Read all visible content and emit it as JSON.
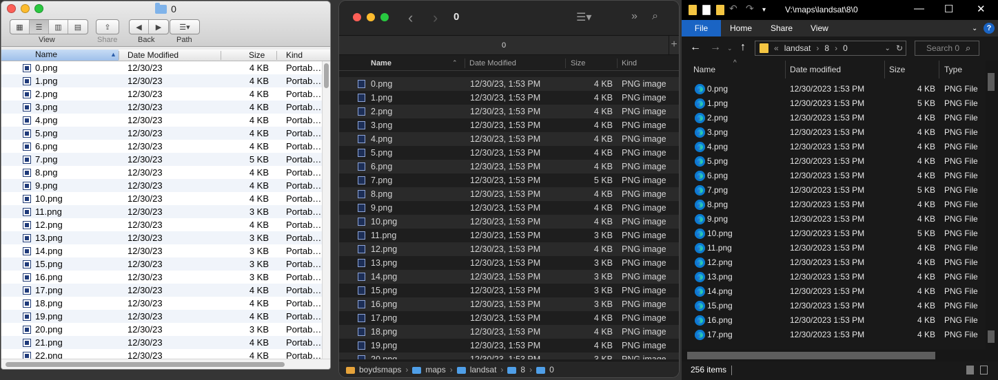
{
  "finder_old": {
    "title": "0",
    "toolbar": {
      "view": "View",
      "share": "Share",
      "back": "Back",
      "path": "Path"
    },
    "columns": {
      "name": "Name",
      "date": "Date Modified",
      "size": "Size",
      "kind": "Kind"
    },
    "rows": [
      {
        "name": "0.png",
        "date": "12/30/23",
        "size": "4 KB",
        "kind": "Portab…"
      },
      {
        "name": "1.png",
        "date": "12/30/23",
        "size": "4 KB",
        "kind": "Portab…"
      },
      {
        "name": "2.png",
        "date": "12/30/23",
        "size": "4 KB",
        "kind": "Portab…"
      },
      {
        "name": "3.png",
        "date": "12/30/23",
        "size": "4 KB",
        "kind": "Portab…"
      },
      {
        "name": "4.png",
        "date": "12/30/23",
        "size": "4 KB",
        "kind": "Portab…"
      },
      {
        "name": "5.png",
        "date": "12/30/23",
        "size": "4 KB",
        "kind": "Portab…"
      },
      {
        "name": "6.png",
        "date": "12/30/23",
        "size": "4 KB",
        "kind": "Portab…"
      },
      {
        "name": "7.png",
        "date": "12/30/23",
        "size": "5 KB",
        "kind": "Portab…"
      },
      {
        "name": "8.png",
        "date": "12/30/23",
        "size": "4 KB",
        "kind": "Portab…"
      },
      {
        "name": "9.png",
        "date": "12/30/23",
        "size": "4 KB",
        "kind": "Portab…"
      },
      {
        "name": "10.png",
        "date": "12/30/23",
        "size": "4 KB",
        "kind": "Portab…"
      },
      {
        "name": "11.png",
        "date": "12/30/23",
        "size": "3 KB",
        "kind": "Portab…"
      },
      {
        "name": "12.png",
        "date": "12/30/23",
        "size": "4 KB",
        "kind": "Portab…"
      },
      {
        "name": "13.png",
        "date": "12/30/23",
        "size": "3 KB",
        "kind": "Portab…"
      },
      {
        "name": "14.png",
        "date": "12/30/23",
        "size": "3 KB",
        "kind": "Portab…"
      },
      {
        "name": "15.png",
        "date": "12/30/23",
        "size": "3 KB",
        "kind": "Portab…"
      },
      {
        "name": "16.png",
        "date": "12/30/23",
        "size": "3 KB",
        "kind": "Portab…"
      },
      {
        "name": "17.png",
        "date": "12/30/23",
        "size": "4 KB",
        "kind": "Portab…"
      },
      {
        "name": "18.png",
        "date": "12/30/23",
        "size": "4 KB",
        "kind": "Portab…"
      },
      {
        "name": "19.png",
        "date": "12/30/23",
        "size": "4 KB",
        "kind": "Portab…"
      },
      {
        "name": "20.png",
        "date": "12/30/23",
        "size": "3 KB",
        "kind": "Portab…"
      },
      {
        "name": "21.png",
        "date": "12/30/23",
        "size": "4 KB",
        "kind": "Portab…"
      },
      {
        "name": "22.png",
        "date": "12/30/23",
        "size": "4 KB",
        "kind": "Portab…"
      }
    ]
  },
  "finder_new": {
    "title": "0",
    "tab_label": "0",
    "columns": {
      "name": "Name",
      "date": "Date Modified",
      "size": "Size",
      "kind": "Kind"
    },
    "rows": [
      {
        "name": "0.png",
        "date": "12/30/23, 1:53 PM",
        "size": "4 KB",
        "kind": "PNG image"
      },
      {
        "name": "1.png",
        "date": "12/30/23, 1:53 PM",
        "size": "4 KB",
        "kind": "PNG image"
      },
      {
        "name": "2.png",
        "date": "12/30/23, 1:53 PM",
        "size": "4 KB",
        "kind": "PNG image"
      },
      {
        "name": "3.png",
        "date": "12/30/23, 1:53 PM",
        "size": "4 KB",
        "kind": "PNG image"
      },
      {
        "name": "4.png",
        "date": "12/30/23, 1:53 PM",
        "size": "4 KB",
        "kind": "PNG image"
      },
      {
        "name": "5.png",
        "date": "12/30/23, 1:53 PM",
        "size": "4 KB",
        "kind": "PNG image"
      },
      {
        "name": "6.png",
        "date": "12/30/23, 1:53 PM",
        "size": "4 KB",
        "kind": "PNG image"
      },
      {
        "name": "7.png",
        "date": "12/30/23, 1:53 PM",
        "size": "5 KB",
        "kind": "PNG image"
      },
      {
        "name": "8.png",
        "date": "12/30/23, 1:53 PM",
        "size": "4 KB",
        "kind": "PNG image"
      },
      {
        "name": "9.png",
        "date": "12/30/23, 1:53 PM",
        "size": "4 KB",
        "kind": "PNG image"
      },
      {
        "name": "10.png",
        "date": "12/30/23, 1:53 PM",
        "size": "4 KB",
        "kind": "PNG image"
      },
      {
        "name": "11.png",
        "date": "12/30/23, 1:53 PM",
        "size": "3 KB",
        "kind": "PNG image"
      },
      {
        "name": "12.png",
        "date": "12/30/23, 1:53 PM",
        "size": "4 KB",
        "kind": "PNG image"
      },
      {
        "name": "13.png",
        "date": "12/30/23, 1:53 PM",
        "size": "3 KB",
        "kind": "PNG image"
      },
      {
        "name": "14.png",
        "date": "12/30/23, 1:53 PM",
        "size": "3 KB",
        "kind": "PNG image"
      },
      {
        "name": "15.png",
        "date": "12/30/23, 1:53 PM",
        "size": "3 KB",
        "kind": "PNG image"
      },
      {
        "name": "16.png",
        "date": "12/30/23, 1:53 PM",
        "size": "3 KB",
        "kind": "PNG image"
      },
      {
        "name": "17.png",
        "date": "12/30/23, 1:53 PM",
        "size": "4 KB",
        "kind": "PNG image"
      },
      {
        "name": "18.png",
        "date": "12/30/23, 1:53 PM",
        "size": "4 KB",
        "kind": "PNG image"
      },
      {
        "name": "19.png",
        "date": "12/30/23, 1:53 PM",
        "size": "4 KB",
        "kind": "PNG image"
      },
      {
        "name": "20.png",
        "date": "12/30/23, 1:53 PM",
        "size": "3 KB",
        "kind": "PNG image"
      }
    ],
    "breadcrumb": [
      "boydsmaps",
      "maps",
      "landsat",
      "8",
      "0"
    ]
  },
  "explorer": {
    "title": "V:\\maps\\landsat\\8\\0",
    "ribbon_tabs": [
      "File",
      "Home",
      "Share",
      "View"
    ],
    "address": [
      "landsat",
      "8",
      "0"
    ],
    "search_placeholder": "Search 0",
    "columns": {
      "name": "Name",
      "date": "Date modified",
      "size": "Size",
      "type": "Type"
    },
    "rows": [
      {
        "name": "0.png",
        "date": "12/30/2023 1:53 PM",
        "size": "4 KB",
        "type": "PNG File"
      },
      {
        "name": "1.png",
        "date": "12/30/2023 1:53 PM",
        "size": "5 KB",
        "type": "PNG File"
      },
      {
        "name": "2.png",
        "date": "12/30/2023 1:53 PM",
        "size": "4 KB",
        "type": "PNG File"
      },
      {
        "name": "3.png",
        "date": "12/30/2023 1:53 PM",
        "size": "4 KB",
        "type": "PNG File"
      },
      {
        "name": "4.png",
        "date": "12/30/2023 1:53 PM",
        "size": "4 KB",
        "type": "PNG File"
      },
      {
        "name": "5.png",
        "date": "12/30/2023 1:53 PM",
        "size": "4 KB",
        "type": "PNG File"
      },
      {
        "name": "6.png",
        "date": "12/30/2023 1:53 PM",
        "size": "4 KB",
        "type": "PNG File"
      },
      {
        "name": "7.png",
        "date": "12/30/2023 1:53 PM",
        "size": "5 KB",
        "type": "PNG File"
      },
      {
        "name": "8.png",
        "date": "12/30/2023 1:53 PM",
        "size": "4 KB",
        "type": "PNG File"
      },
      {
        "name": "9.png",
        "date": "12/30/2023 1:53 PM",
        "size": "4 KB",
        "type": "PNG File"
      },
      {
        "name": "10.png",
        "date": "12/30/2023 1:53 PM",
        "size": "5 KB",
        "type": "PNG File"
      },
      {
        "name": "11.png",
        "date": "12/30/2023 1:53 PM",
        "size": "4 KB",
        "type": "PNG File"
      },
      {
        "name": "12.png",
        "date": "12/30/2023 1:53 PM",
        "size": "4 KB",
        "type": "PNG File"
      },
      {
        "name": "13.png",
        "date": "12/30/2023 1:53 PM",
        "size": "4 KB",
        "type": "PNG File"
      },
      {
        "name": "14.png",
        "date": "12/30/2023 1:53 PM",
        "size": "4 KB",
        "type": "PNG File"
      },
      {
        "name": "15.png",
        "date": "12/30/2023 1:53 PM",
        "size": "4 KB",
        "type": "PNG File"
      },
      {
        "name": "16.png",
        "date": "12/30/2023 1:53 PM",
        "size": "4 KB",
        "type": "PNG File"
      },
      {
        "name": "17.png",
        "date": "12/30/2023 1:53 PM",
        "size": "4 KB",
        "type": "PNG File"
      }
    ],
    "status_count": "256 items"
  },
  "colors": {
    "explorer_accent": "#1a64c4",
    "finder_header_selected": "#9fc0ea"
  }
}
